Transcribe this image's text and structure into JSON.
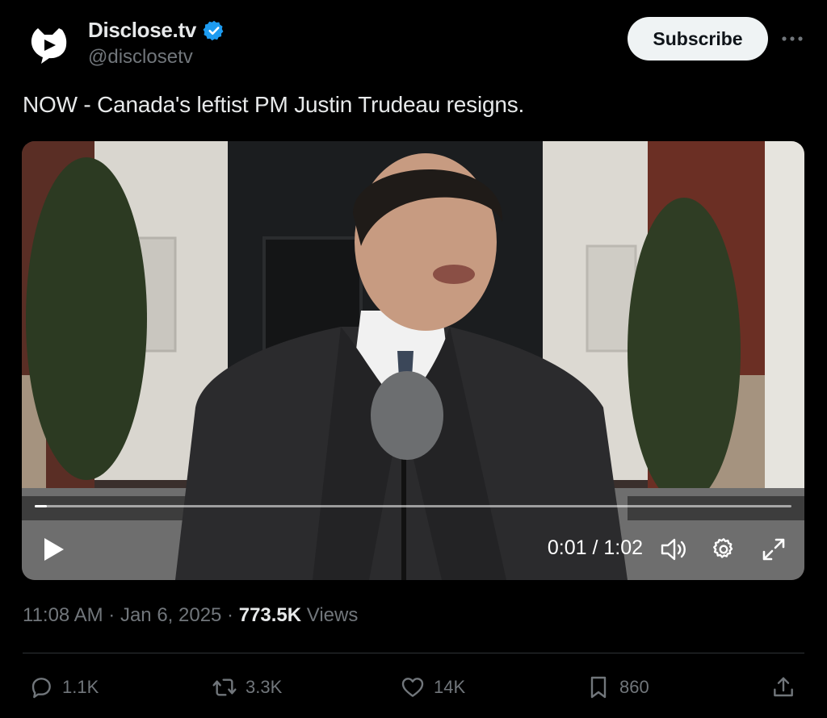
{
  "account": {
    "display_name": "Disclose.tv",
    "handle": "@disclosetv",
    "verified": true,
    "avatar_icon": "disclose-logo-icon",
    "verified_icon": "verified-badge-icon"
  },
  "header": {
    "subscribe_label": "Subscribe",
    "more_icon": "more-horizontal-icon"
  },
  "tweet": {
    "text": "NOW - Canada's leftist PM Justin Trudeau resigns."
  },
  "video": {
    "current_time": "0:01 / 1:02",
    "progress": 0.016,
    "icons": [
      "play-icon",
      "volume-icon",
      "settings-gear-icon",
      "fullscreen-icon"
    ]
  },
  "meta": {
    "time": "11:08 AM",
    "date": "Jan 6, 2025",
    "sep1": " · ",
    "sep2": " · ",
    "views_count": "773.5K",
    "views_label": " Views"
  },
  "actions": {
    "replies": "1.1K",
    "reposts": "3.3K",
    "likes": "14K",
    "bookmarks": "860"
  },
  "colors": {
    "background": "#000000",
    "text": "#e7e9ea",
    "muted": "#71767b",
    "verified": "#1d9bf0",
    "subscribe_bg": "#eff3f4"
  }
}
